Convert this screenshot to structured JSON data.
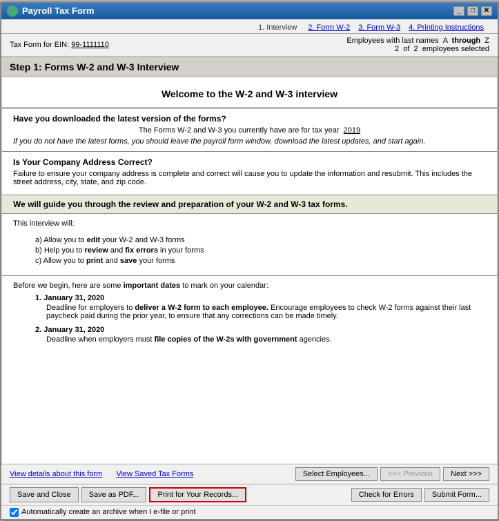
{
  "window": {
    "title": "Payroll Tax Form",
    "icon": "payroll-icon"
  },
  "nav": {
    "tabs": [
      {
        "id": "interview",
        "label": "1. Interview",
        "active": true,
        "is_link": false
      },
      {
        "id": "form-w2",
        "label": "2. Form W-2",
        "active": false,
        "is_link": true
      },
      {
        "id": "form-w3",
        "label": "3. Form W-3",
        "active": false,
        "is_link": true
      },
      {
        "id": "printing",
        "label": "4. Printing Instructions",
        "active": false,
        "is_link": true
      }
    ]
  },
  "employee_bar": {
    "tax_form_label": "Tax Form for EIN:",
    "ein_value": "99-1111110",
    "employees_label": "Employees with last names",
    "range_from": "A",
    "through": "through",
    "range_to": "Z",
    "count": "2",
    "of": "of",
    "total": "2",
    "employees_selected": "employees selected"
  },
  "step_header": "Step 1:   Forms W-2 and W-3 Interview",
  "welcome_title": "Welcome to the W-2 and W-3 interview",
  "sections": [
    {
      "id": "downloaded-question",
      "header": "Have you downloaded the latest version of the forms?",
      "body": "The Forms W-2 and W-3 you currently have are for tax year",
      "year": "2019",
      "italic": "If you do not have the latest forms, you should leave the payroll form window, download the latest updates, and start again."
    },
    {
      "id": "company-address",
      "header": "Is Your Company Address Correct?",
      "body": "Failure to ensure your company address is complete and correct will cause you to update the information and resubmit.  This includes the street address, city, state, and zip code."
    }
  ],
  "guide_header": "We will guide you through the review and preparation of your W-2 and W-3 tax forms.",
  "interview_will": {
    "intro": "This interview will:",
    "items": [
      {
        "letter": "a)",
        "text_before": "Allow you to ",
        "bold": "edit",
        "text_after": " your W-2 and W-3 forms"
      },
      {
        "letter": "b)",
        "text_before": "Help you to ",
        "bold": "review",
        "text_middle": " and ",
        "bold2": "fix errors",
        "text_after": " in your forms"
      },
      {
        "letter": "c)",
        "text_before": "Allow you to ",
        "bold": "print",
        "text_middle": " and ",
        "bold2": "save",
        "text_after": " your forms"
      }
    ]
  },
  "important_dates": {
    "intro": "Before we begin, here are some important dates to mark on your calendar:",
    "intro_bold": "important dates",
    "dates": [
      {
        "number": "1.",
        "label": "January 31, 2020",
        "desc_before": "Deadline for employers to ",
        "desc_bold": "deliver a W-2 form to each employee.",
        "desc_after": " Encourage employees to check W-2 forms against their last paycheck paid during the prior year, to ensure that any corrections can be made timely."
      },
      {
        "number": "2.",
        "label": "January 31, 2020",
        "desc_before": "Deadline when employers must ",
        "desc_bold": "file copies of the W-2s with government",
        "desc_after": " agencies."
      }
    ]
  },
  "bottom_links": {
    "left_link1": "View details about this form",
    "left_link2": "View Saved Tax Forms",
    "select_employees": "Select Employees...",
    "previous": "<<<  Previous",
    "next": "Next  >>>"
  },
  "action_buttons": {
    "save_close": "Save and Close",
    "save_pdf": "Save as PDF...",
    "print_records": "Print for Your Records...",
    "check_errors": "Check for Errors",
    "submit_form": "Submit Form..."
  },
  "checkbox": {
    "label": "Automatically create an archive when I e-file or print",
    "checked": true
  }
}
